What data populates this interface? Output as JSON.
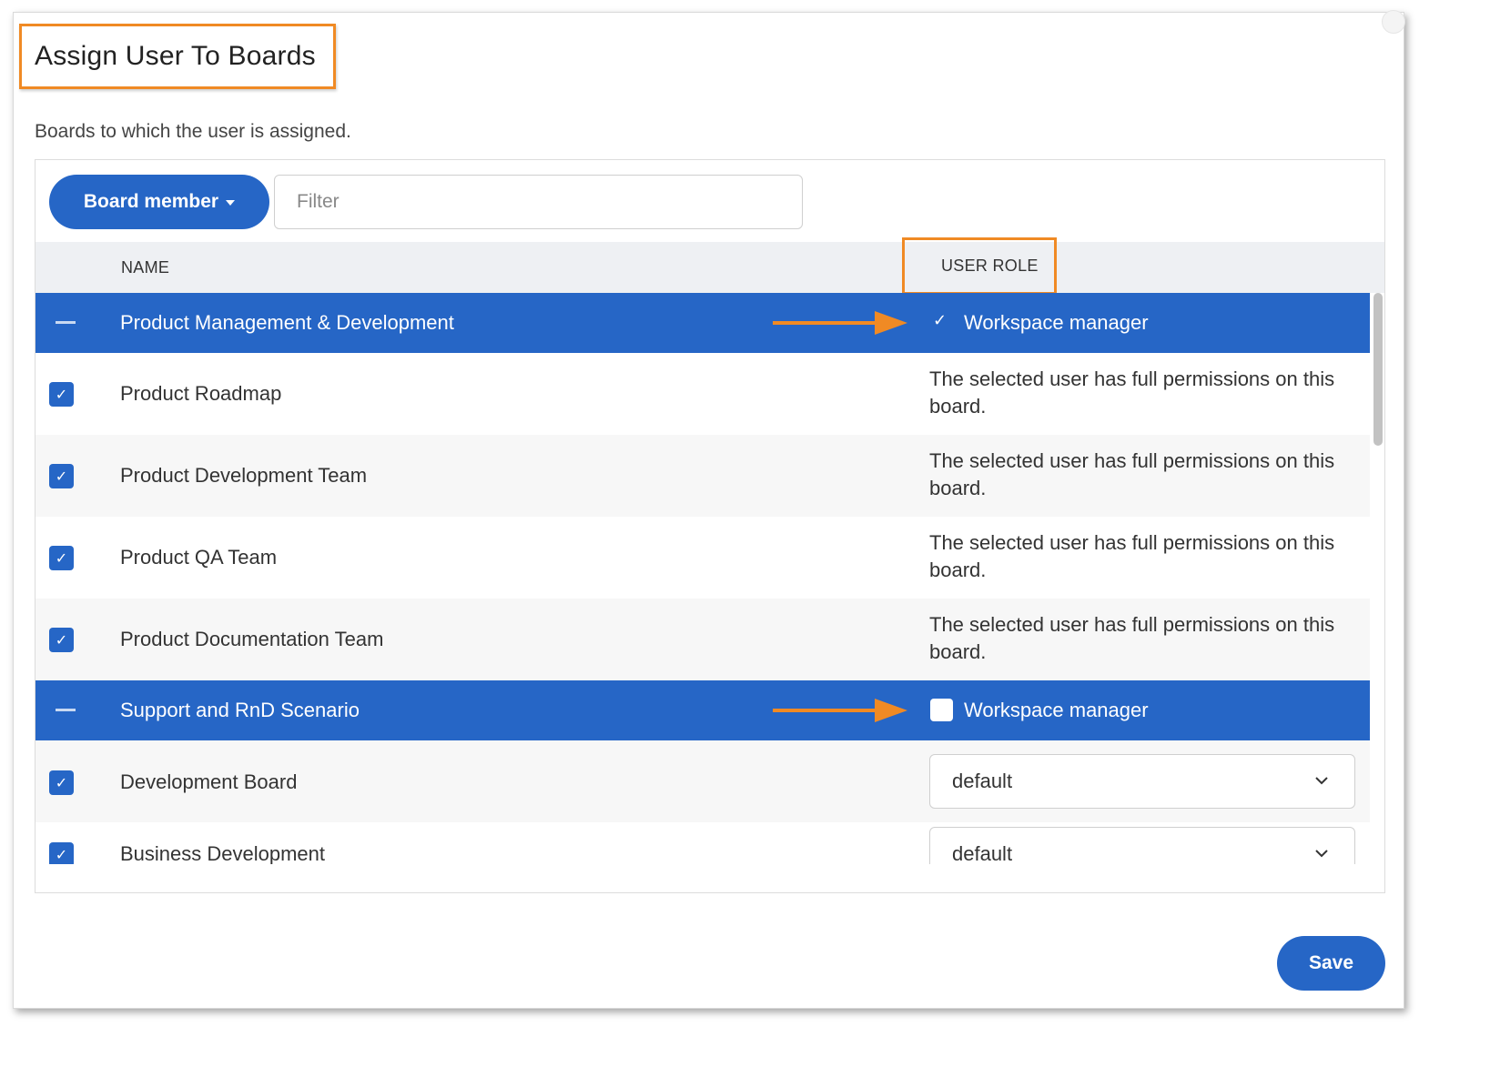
{
  "dialog": {
    "title": "Assign User To Boards",
    "subtitle": "Boards to which the user is assigned.",
    "save_label": "Save"
  },
  "toolbar": {
    "role_button_label": "Board member",
    "filter_placeholder": "Filter"
  },
  "table": {
    "headers": {
      "name": "NAME",
      "user_role": "USER ROLE"
    },
    "groups": [
      {
        "name": "Product Management & Development",
        "workspace_manager_label": "Workspace manager",
        "workspace_manager_checked": true,
        "boards": [
          {
            "name": "Product Roadmap",
            "checked": true,
            "role_text_line1": "The selected user has full permissions on this",
            "role_text_line2": "board."
          },
          {
            "name": "Product Development Team",
            "checked": true,
            "role_text_line1": "The selected user has full permissions on this",
            "role_text_line2": "board."
          },
          {
            "name": "Product QA Team",
            "checked": true,
            "role_text_line1": "The selected user has full permissions on this",
            "role_text_line2": "board."
          },
          {
            "name": "Product Documentation Team",
            "checked": true,
            "role_text_line1": "The selected user has full permissions on this",
            "role_text_line2": "board."
          }
        ]
      },
      {
        "name": "Support and RnD Scenario",
        "workspace_manager_label": "Workspace manager",
        "workspace_manager_checked": false,
        "boards": [
          {
            "name": "Development Board",
            "checked": true,
            "role_select": "default"
          },
          {
            "name": "Business Development",
            "checked": true,
            "role_select": "default"
          }
        ]
      }
    ]
  },
  "colors": {
    "primary": "#2666c6",
    "highlight": "#f08a24",
    "header_bg": "#eef0f3"
  }
}
